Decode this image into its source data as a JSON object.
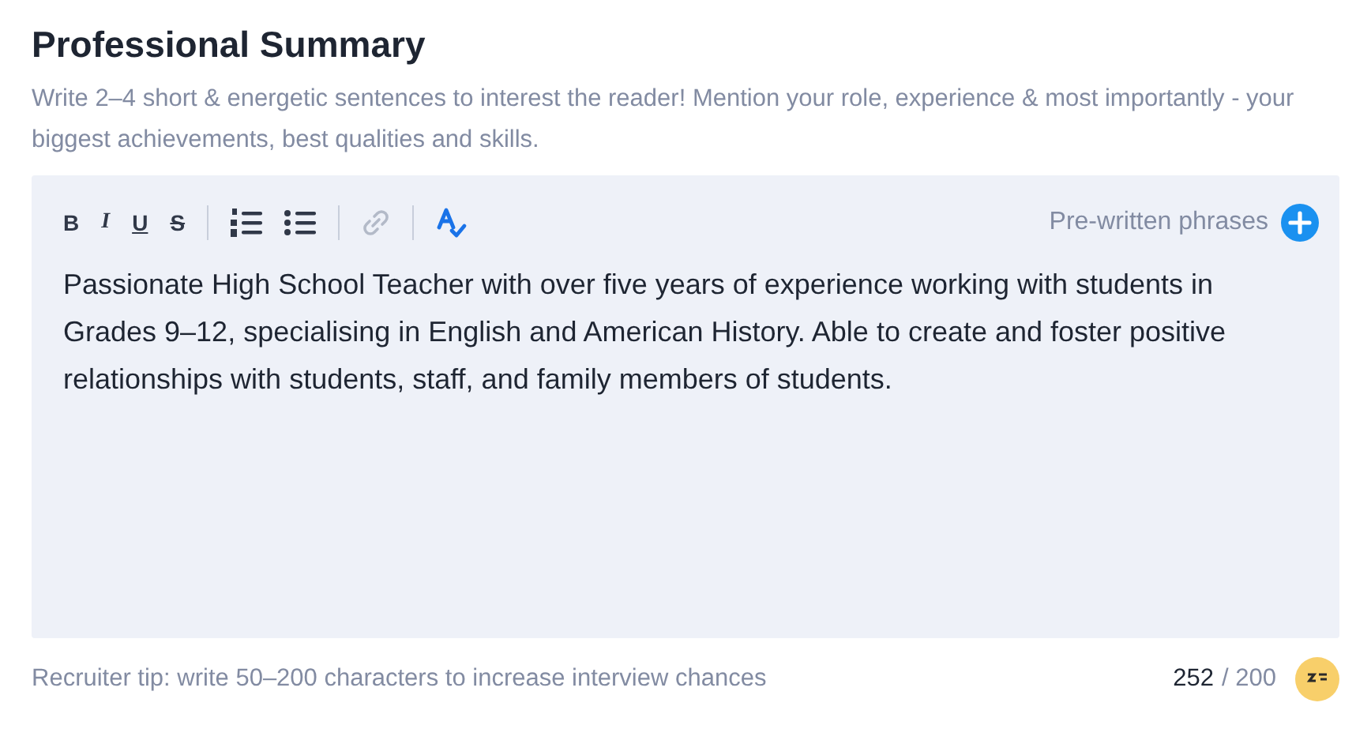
{
  "title": "Professional Summary",
  "description": "Write 2–4 short & energetic sentences to interest the reader! Mention your role, experience & most importantly - your biggest achievements, best qualities and skills.",
  "toolbar": [
    {
      "kind": "bold",
      "label": "B"
    },
    {
      "kind": "italic",
      "label": "I"
    },
    {
      "kind": "underline",
      "label": "U"
    },
    {
      "kind": "strike",
      "label": "S"
    },
    {
      "kind": "divider"
    },
    {
      "kind": "ordered-list"
    },
    {
      "kind": "bullet-list"
    },
    {
      "kind": "divider"
    },
    {
      "kind": "link",
      "disabled": true
    },
    {
      "kind": "divider"
    },
    {
      "kind": "spellcheck",
      "disabled": false
    }
  ],
  "phrases_button": {
    "label": "Pre-written phrases"
  },
  "body": "Passionate High School Teacher with over five years of experience working with students in Grades 9–12, specialising in English and American History. Able to create and foster positive relationships with students, staff, and family members of students.",
  "tip": "Recruiter tip: write 50–200 characters to increase interview chances",
  "counter": {
    "count": "252",
    "limit": "/ 200"
  }
}
